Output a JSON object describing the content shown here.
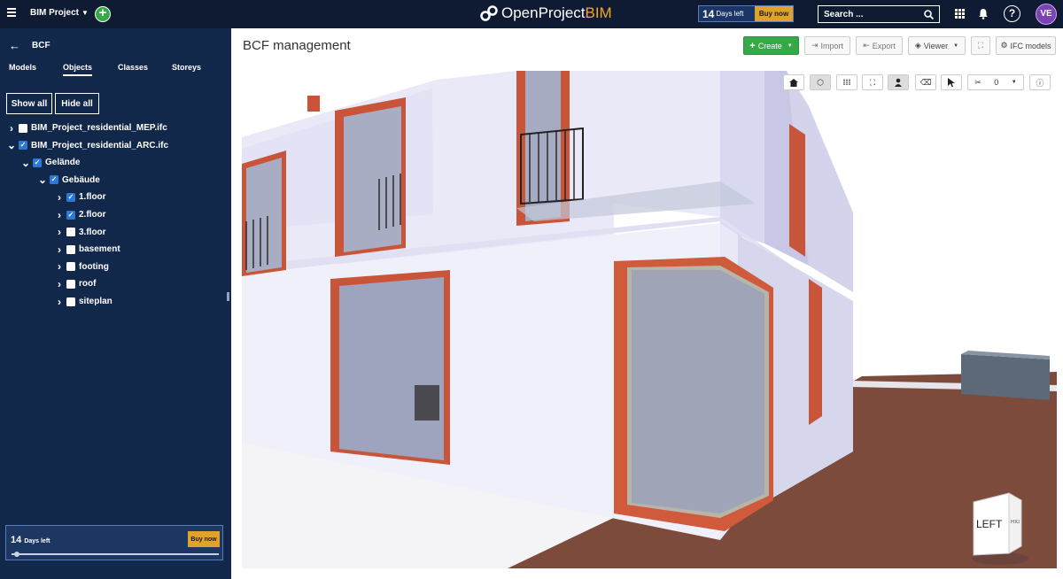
{
  "topbar": {
    "project": "BIM Project",
    "logo_main": "OpenProject",
    "logo_accent": "BIM",
    "trial_days": "14",
    "trial_days_label": "Days left",
    "buy_now": "Buy now",
    "search_placeholder": "Search ...",
    "help": "?",
    "avatar": "VE"
  },
  "sidebar": {
    "title": "BCF",
    "tabs": [
      "Models",
      "Objects",
      "Classes",
      "Storeys"
    ],
    "show_all": "Show all",
    "hide_all": "Hide all",
    "tree": [
      {
        "label": "BIM_Project_residential_MEP.ifc",
        "checked": false,
        "expanded": false
      },
      {
        "label": "BIM_Project_residential_ARC.ifc",
        "checked": true,
        "expanded": true
      },
      {
        "label": "Gelände",
        "checked": true,
        "expanded": true
      },
      {
        "label": "Gebäude",
        "checked": true,
        "expanded": true
      },
      {
        "label": "1.floor",
        "checked": true,
        "expanded": false
      },
      {
        "label": "2.floor",
        "checked": true,
        "expanded": false
      },
      {
        "label": "3.floor",
        "checked": false,
        "expanded": false
      },
      {
        "label": "basement",
        "checked": false,
        "expanded": false
      },
      {
        "label": "footing",
        "checked": false,
        "expanded": false
      },
      {
        "label": "roof",
        "checked": false,
        "expanded": false
      },
      {
        "label": "siteplan",
        "checked": false,
        "expanded": false
      }
    ],
    "trial_days": "14",
    "trial_days_label": "Days left",
    "buy_now": "Buy now",
    "trial_progress": 0.02
  },
  "main": {
    "title": "BCF management",
    "toolbar": {
      "create": "Create",
      "import": "Import",
      "export": "Export",
      "viewer": "Viewer",
      "ifc_models": "IFC models"
    },
    "viewer_tools": {
      "section_count": "0",
      "navcube_label": "LEFT",
      "navcube_side": "RIGHT"
    }
  },
  "colors": {
    "topbar": "#0e1b32",
    "sidebar": "#12284a",
    "create_green": "#35a948",
    "buy_orange": "#e0a32a",
    "avatar": "#7b42b3"
  }
}
